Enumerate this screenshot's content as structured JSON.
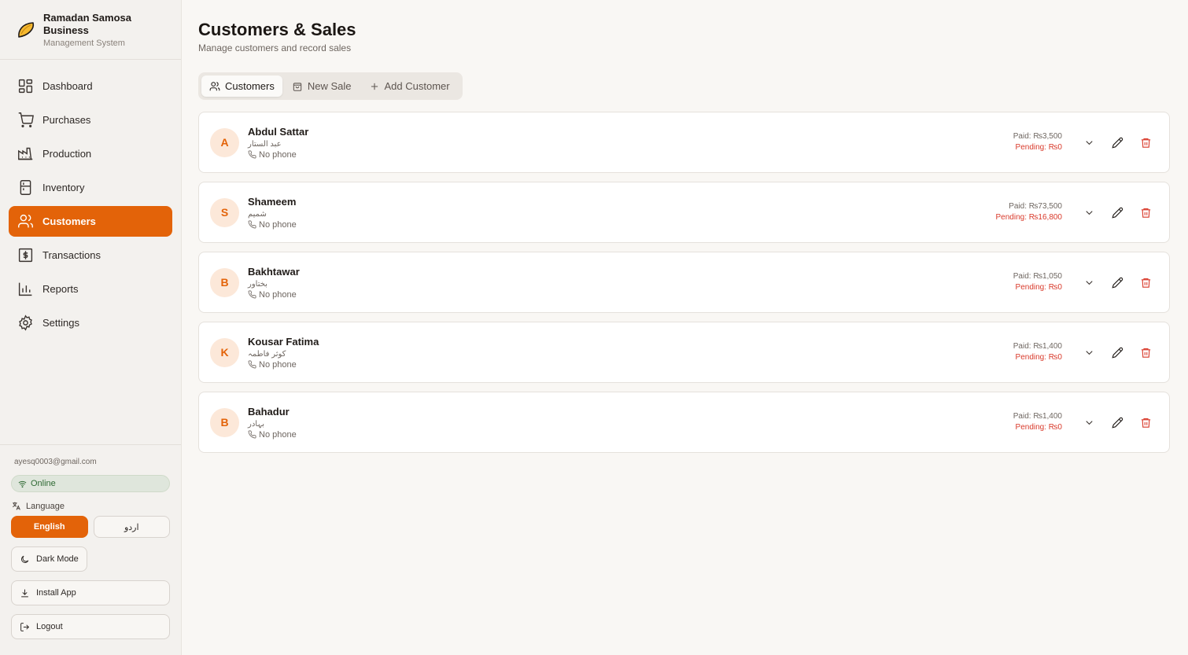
{
  "brand": {
    "title": "Ramadan Samosa Business",
    "subtitle": "Management System",
    "logo_icon": "samosa-icon"
  },
  "nav": {
    "items": [
      {
        "label": "Dashboard",
        "icon": "dashboard-icon"
      },
      {
        "label": "Purchases",
        "icon": "cart-icon"
      },
      {
        "label": "Production",
        "icon": "factory-icon"
      },
      {
        "label": "Inventory",
        "icon": "fridge-icon"
      },
      {
        "label": "Customers",
        "icon": "users-icon",
        "active": true
      },
      {
        "label": "Transactions",
        "icon": "dollar-icon"
      },
      {
        "label": "Reports",
        "icon": "bar-chart-icon"
      },
      {
        "label": "Settings",
        "icon": "gear-icon"
      }
    ]
  },
  "account": {
    "email": "ayesq0003@gmail.com",
    "status": "Online",
    "language_label": "Language",
    "lang_english": "English",
    "lang_urdu": "اردو",
    "dark_mode": "Dark Mode",
    "install_app": "Install App",
    "logout": "Logout"
  },
  "page": {
    "title": "Customers & Sales",
    "subtitle": "Manage customers and record sales"
  },
  "tabs": [
    {
      "label": "Customers",
      "icon": "users-icon",
      "active": true
    },
    {
      "label": "New Sale",
      "icon": "shopping-bag-icon"
    },
    {
      "label": "Add Customer",
      "icon": "plus-icon"
    }
  ],
  "customers": [
    {
      "initial": "A",
      "name": "Abdul Sattar",
      "urdu": "عبد الستار",
      "phone": "No phone",
      "paid": "Paid: ₨3,500",
      "pending": "Pending: ₨0"
    },
    {
      "initial": "S",
      "name": "Shameem",
      "urdu": "شمیم",
      "phone": "No phone",
      "paid": "Paid: ₨73,500",
      "pending": "Pending: ₨16,800"
    },
    {
      "initial": "B",
      "name": "Bakhtawar",
      "urdu": "بختاور",
      "phone": "No phone",
      "paid": "Paid: ₨1,050",
      "pending": "Pending: ₨0"
    },
    {
      "initial": "K",
      "name": "Kousar Fatima",
      "urdu": "کوثر فاطمہ",
      "phone": "No phone",
      "paid": "Paid: ₨1,400",
      "pending": "Pending: ₨0"
    },
    {
      "initial": "B",
      "name": "Bahadur",
      "urdu": "بہادر",
      "phone": "No phone",
      "paid": "Paid: ₨1,400",
      "pending": "Pending: ₨0"
    }
  ],
  "colors": {
    "accent": "#e36309",
    "pending": "#d93a2b",
    "delete": "#d93a2b"
  }
}
